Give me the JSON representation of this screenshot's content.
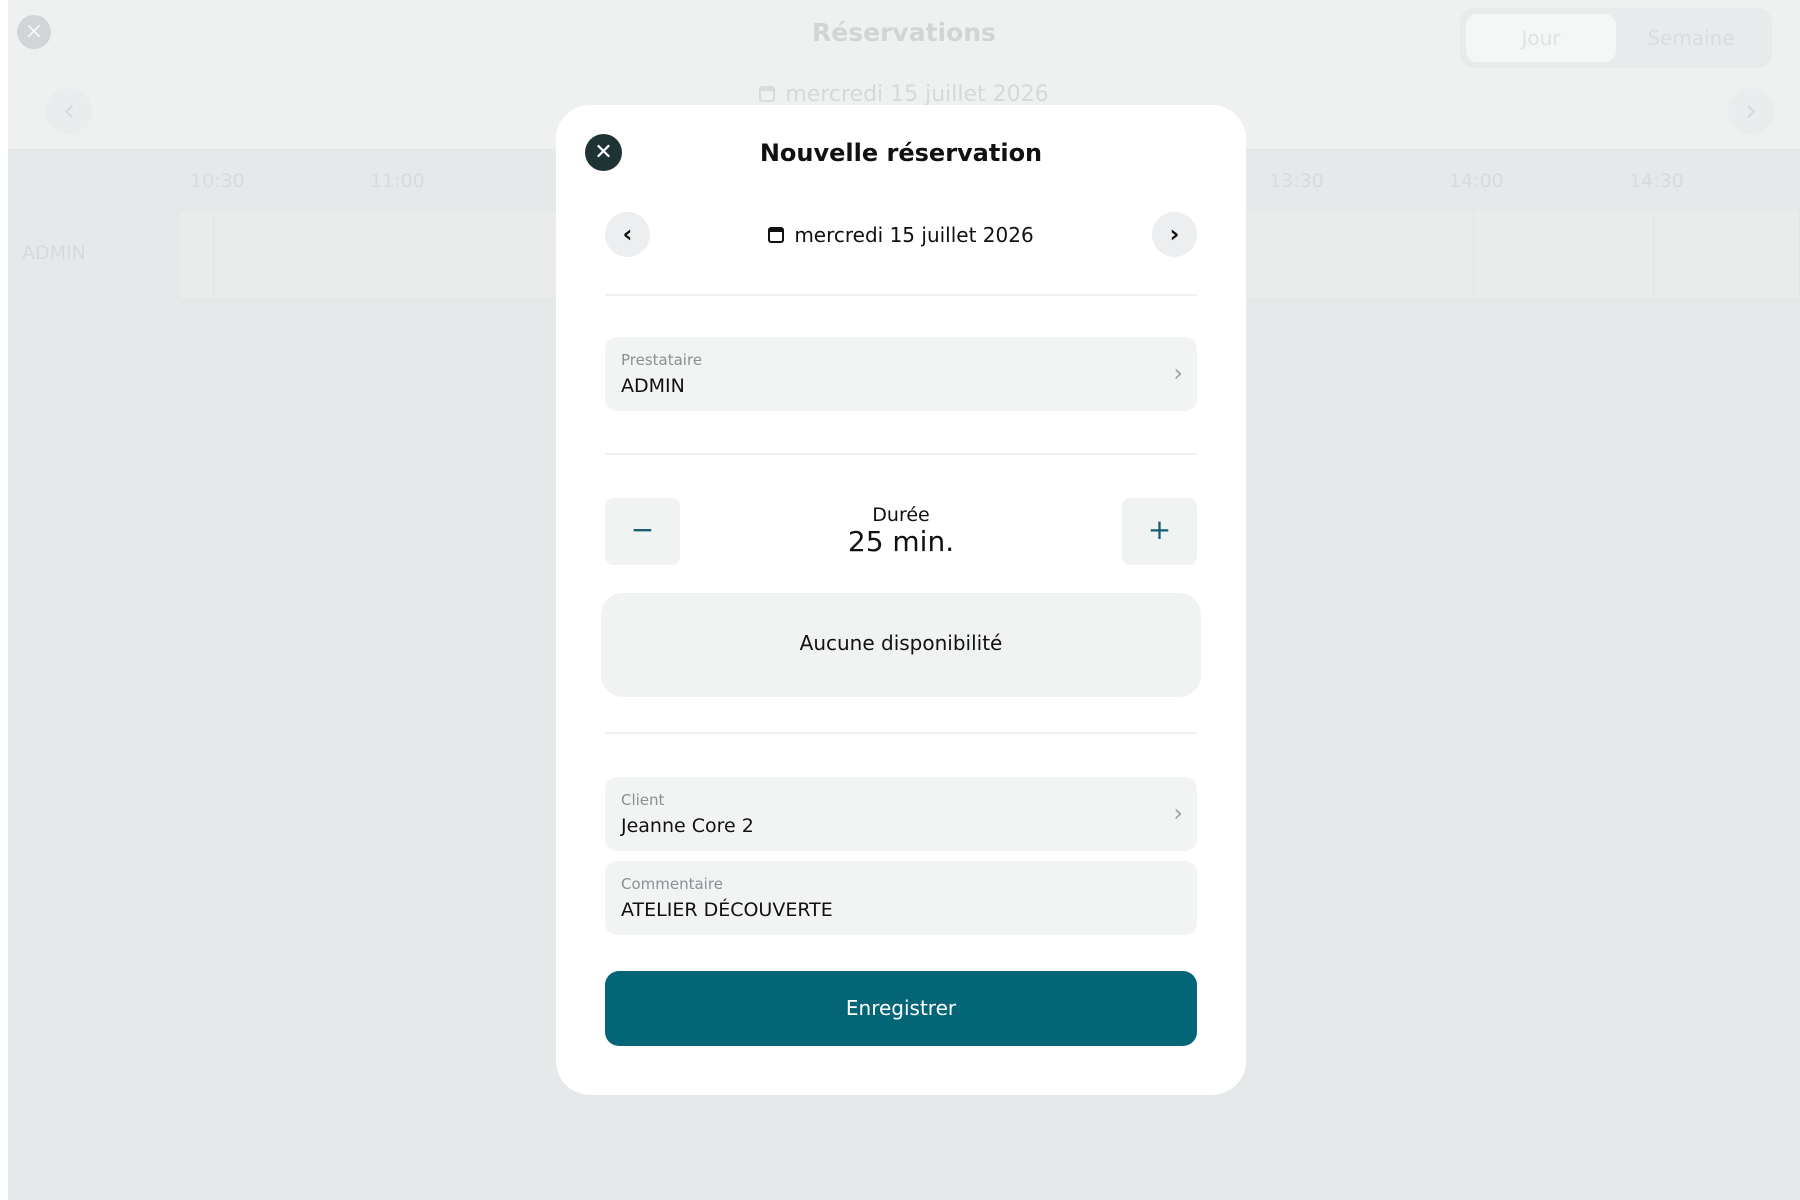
{
  "background": {
    "title": "Réservations",
    "view_toggle": {
      "day": "Jour",
      "week": "Semaine"
    },
    "date": "mercredi 15 juillet 2026",
    "times": [
      "10:30",
      "11:00",
      "13:30",
      "14:00",
      "14:30"
    ],
    "row_label": "ADMIN"
  },
  "modal": {
    "title": "Nouvelle réservation",
    "date": "mercredi 15 juillet 2026",
    "provider": {
      "label": "Prestataire",
      "value": "ADMIN"
    },
    "duration": {
      "label": "Durée",
      "value": "25 min.",
      "decrement": "−",
      "increment": "+"
    },
    "availability": "Aucune disponibilité",
    "client": {
      "label": "Client",
      "value": "Jeanne Core 2"
    },
    "comment": {
      "label": "Commentaire",
      "value": "ATELIER DÉCOUVERTE"
    },
    "save_label": "Enregistrer"
  },
  "colors": {
    "primary": "#046577",
    "close_button": "#1f3335",
    "field_background": "#f2f3f3"
  }
}
